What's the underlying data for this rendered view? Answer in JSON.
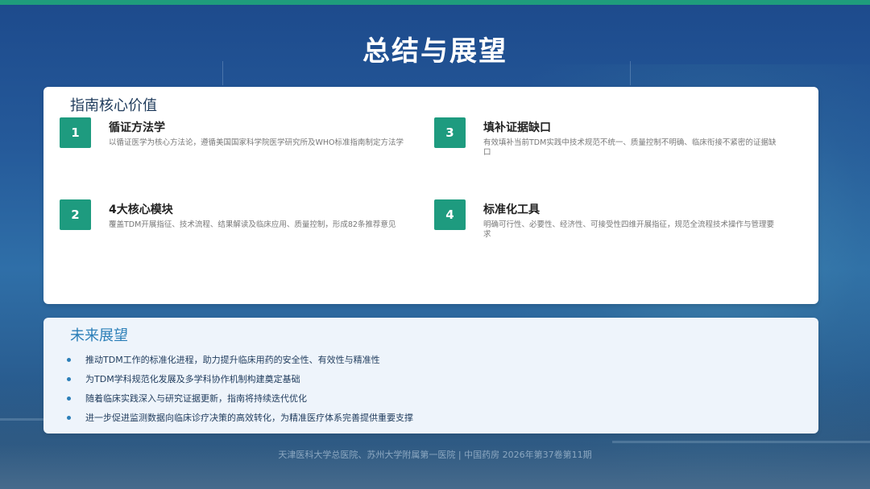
{
  "slide": {
    "title": "总结与展望",
    "colors": {
      "accent": "#1e9b7f",
      "bullet": "#2c7fb8",
      "background_top": "#1d4a8c",
      "background_bottom": "#1e4773"
    }
  },
  "core_value": {
    "title": "指南核心价值",
    "items": [
      {
        "number": "1",
        "heading": "循证方法学",
        "desc": "以循证医学为核心方法论，遵循美国国家科学院医学研究所及WHO标准指南制定方法学"
      },
      {
        "number": "3",
        "heading": "填补证据缺口",
        "desc": "有效填补当前TDM实践中技术规范不统一、质量控制不明确、临床衔接不紧密的证据缺口"
      },
      {
        "number": "2",
        "heading": "4大核心模块",
        "desc": "覆盖TDM开展指征、技术流程、结果解读及临床应用、质量控制，形成82条推荐意见"
      },
      {
        "number": "4",
        "heading": "标准化工具",
        "desc": "明确可行性、必要性、经济性、可接受性四维开展指征，规范全流程技术操作与管理要求"
      }
    ]
  },
  "outlook": {
    "title": "未来展望",
    "bullets": [
      "推动TDM工作的标准化进程，助力提升临床用药的安全性、有效性与精准性",
      "为TDM学科规范化发展及多学科协作机制构建奠定基础",
      "随着临床实践深入与研究证据更新，指南将持续迭代优化",
      "进一步促进监测数据向临床诊疗决策的高效转化，为精准医疗体系完善提供重要支撑"
    ]
  },
  "footer": {
    "text": "天津医科大学总医院、苏州大学附属第一医院 | 中国药房 2026年第37卷第11期"
  }
}
